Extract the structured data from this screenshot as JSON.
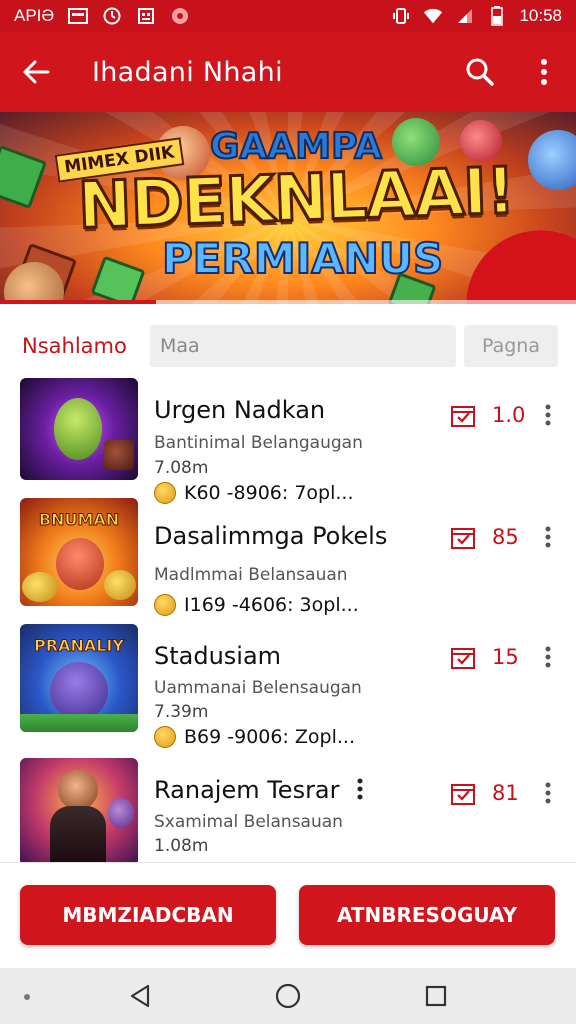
{
  "status_bar": {
    "left_text": "APIƏ",
    "time": "10:58"
  },
  "app_bar": {
    "title": "Ihadani Nhahi"
  },
  "banner": {
    "badge_text": "MIMEX DIIK",
    "top_text": "GAAMPA",
    "main_text": "NDEKNLAAI!",
    "sub_text": "PERMIANUS",
    "slide_progress": 0.27
  },
  "filter": {
    "label": "Nsahlamo",
    "input_value": "Maa",
    "button_label": "Pagna"
  },
  "items": [
    {
      "title": "Urgen Nadkan",
      "subtitle": "Bantinimal Belangaugan",
      "size": "7.08m",
      "meta": "K60 -8906: 7opl...",
      "count": "1.0",
      "thumb_title": "",
      "thumb_colors": [
        "#5a1a8a",
        "#b03bd8",
        "#1a0a30"
      ]
    },
    {
      "title": "Dasalimmga Pokels",
      "subtitle": "Madlmmai Belansauan",
      "size": "",
      "meta": "I169 -4606: 3opl...",
      "count": "85",
      "thumb_title": "BNUMAN",
      "thumb_colors": [
        "#e2631b",
        "#f7b23a",
        "#8a1d10"
      ]
    },
    {
      "title": "Stadusiam",
      "subtitle": "Uammanai Belensaugan",
      "size": "7.39m",
      "meta": "B69 -9006: Zopl...",
      "count": "15",
      "thumb_title": "PRANALIY",
      "thumb_colors": [
        "#2a57c8",
        "#47a2f0",
        "#1c2a66"
      ]
    },
    {
      "title": "Ranajem Tesrar",
      "subtitle": "Sxamimal Belansauan",
      "size": "1.08m",
      "meta": "",
      "count": "81",
      "thumb_title": "",
      "thumb_colors": [
        "#c23a6a",
        "#ff9a3a",
        "#3a1050"
      ]
    }
  ],
  "actions": {
    "left_label": "MBMZIADCBAN",
    "right_label": "ATNBRESOGUAY"
  },
  "colors": {
    "primary": "#d0151d",
    "status_bar": "#c8121b"
  }
}
